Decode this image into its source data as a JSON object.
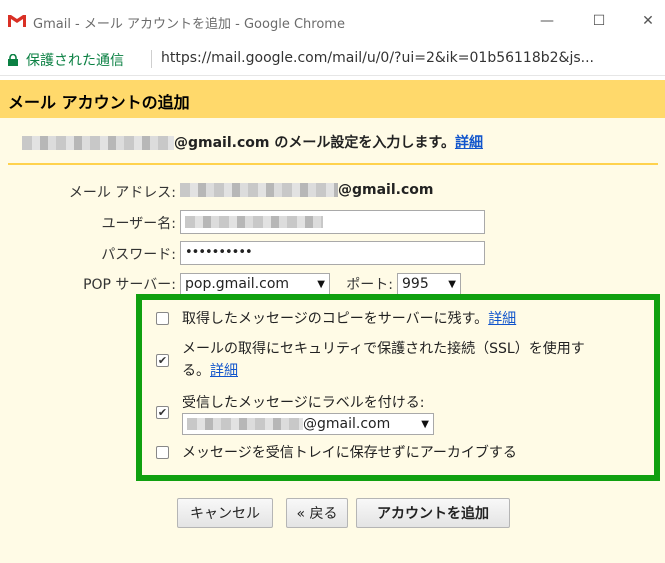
{
  "window": {
    "title": "Gmail - メール アカウントを追加 - Google Chrome",
    "minimize": "—",
    "maximize": "☐",
    "close": "✕"
  },
  "address_bar": {
    "secure_label": "保護された通信",
    "url": "https://mail.google.com/mail/u/0/?ui=2&ik=01b56118b2&js..."
  },
  "dialog": {
    "title": "メール アカウントの追加",
    "intro_suffix": "@gmail.com のメール設定を入力します。",
    "intro_link": "詳細",
    "email_label": "メール アドレス:",
    "email_suffix": "@gmail.com",
    "username_label": "ユーザー名:",
    "password_label": "パスワード:",
    "password_value": "••••••••••",
    "pop_label": "POP サーバー:",
    "pop_value": "pop.gmail.com",
    "port_label": "ポート:",
    "port_value": "995",
    "options": {
      "keep_copy": {
        "label": "取得したメッセージのコピーをサーバーに残す。",
        "link": "詳細",
        "checked": false
      },
      "ssl": {
        "label_line1": "メールの取得にセキュリティで保護された接続（SSL）を使用す",
        "label_line2": "る。",
        "link": "詳細",
        "checked": true
      },
      "label": {
        "label": "受信したメッセージにラベルを付ける:",
        "select_suffix": "@gmail.com",
        "checked": true
      },
      "archive": {
        "label": "メッセージを受信トレイに保存せずにアーカイブする",
        "checked": false
      }
    },
    "buttons": {
      "cancel": "キャンセル",
      "back": "« 戻る",
      "add": "アカウントを追加"
    },
    "check_mark": "✔"
  },
  "colors": {
    "header_bg": "#ffd96b",
    "content_bg": "#fffbe6",
    "highlight_border": "#10a010",
    "link": "#1155cc",
    "secure_green": "#0b8043"
  }
}
